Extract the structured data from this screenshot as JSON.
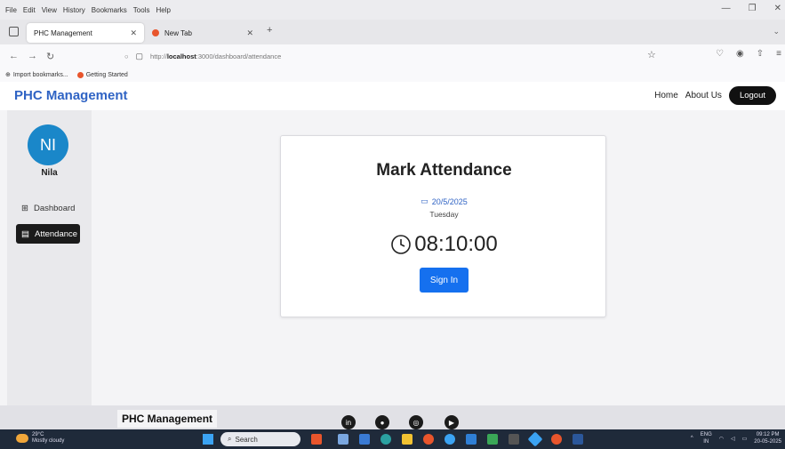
{
  "browser": {
    "menu": [
      "File",
      "Edit",
      "View",
      "History",
      "Bookmarks",
      "Tools",
      "Help"
    ],
    "tabs": [
      {
        "label": "PHC Management",
        "active": true
      },
      {
        "label": "New Tab",
        "active": false
      }
    ],
    "url_prefix": "http://",
    "url_host": "localhost",
    "url_path": ":3000/dashboard/attendance",
    "bookmarks": [
      "Import bookmarks...",
      "Getting Started"
    ]
  },
  "app": {
    "brand": "PHC Management",
    "nav": {
      "home": "Home",
      "about": "About Us",
      "logout": "Logout"
    },
    "accent": "#2f63c4"
  },
  "sidebar": {
    "avatar_initials": "NI",
    "user_name": "Nila",
    "items": [
      {
        "label": "Dashboard",
        "icon": "grid-icon",
        "active": false
      },
      {
        "label": "Attendance",
        "icon": "calendar-icon",
        "active": true
      }
    ]
  },
  "card": {
    "title": "Mark Attendance",
    "date": "20/5/2025",
    "day": "Tuesday",
    "time": "08:10:00",
    "sign_in": "Sign In",
    "button_color": "#1570ef"
  },
  "footer": {
    "brand": "PHC Management",
    "social": [
      "in",
      "gh",
      "ig",
      "yt"
    ]
  },
  "taskbar": {
    "weather_temp": "29°C",
    "weather_desc": "Mostly cloudy",
    "search": "Search",
    "lang_top": "ENG",
    "lang_bottom": "IN",
    "time": "09:12 PM",
    "date": "20-05-2025"
  }
}
